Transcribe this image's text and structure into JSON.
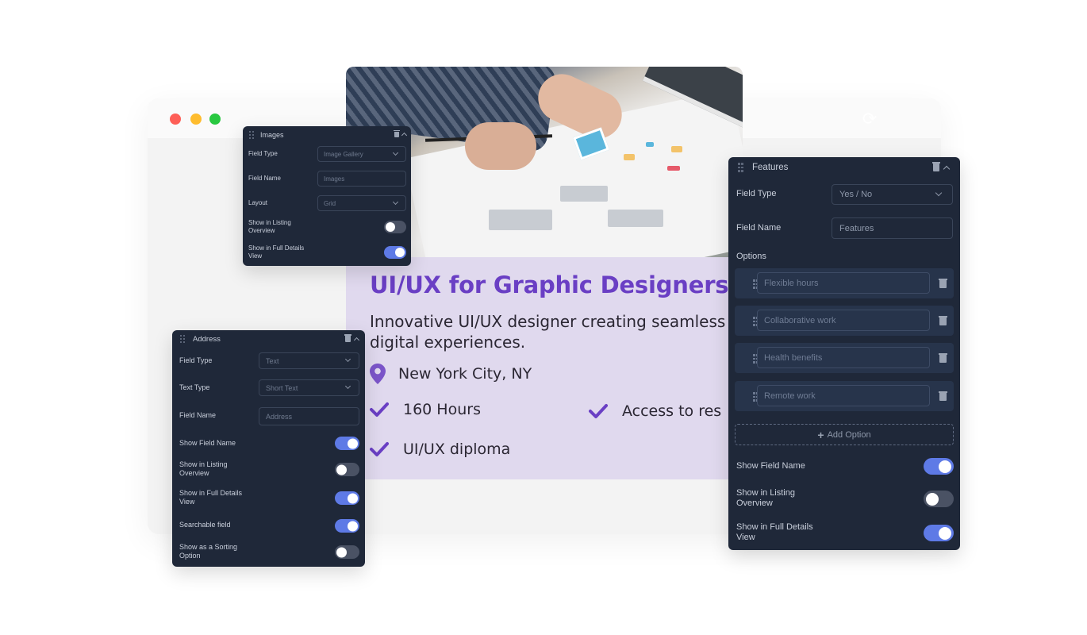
{
  "window": {
    "controls": [
      "close",
      "minimize",
      "maximize"
    ],
    "refresh_icon": "refresh-icon"
  },
  "course": {
    "title": "UI/UX for Graphic Designers",
    "description": "Innovative UI/UX designer creating seamless digital experiences.",
    "location": "New York City, NY",
    "features": [
      "160 Hours",
      "Access to res",
      "UI/UX diploma"
    ],
    "accent_color": "#6a3fc4",
    "background_color": "#e0d9ee"
  },
  "images_panel": {
    "title": "Images",
    "rows": [
      {
        "label": "Field Type",
        "value": "Image Gallery",
        "type": "select"
      },
      {
        "label": "Field Name",
        "value": "Images",
        "type": "input"
      },
      {
        "label": "Layout",
        "value": "Grid",
        "type": "select"
      }
    ],
    "toggles": [
      {
        "label": "Show in Listing Overview",
        "on": false
      },
      {
        "label": "Show in Full Details View",
        "on": true
      }
    ]
  },
  "address_panel": {
    "title": "Address",
    "rows": [
      {
        "label": "Field Type",
        "value": "Text",
        "type": "select"
      },
      {
        "label": "Text Type",
        "value": "Short Text",
        "type": "select"
      },
      {
        "label": "Field Name",
        "value": "Address",
        "type": "input"
      }
    ],
    "toggles": [
      {
        "label": "Show Field Name",
        "on": true
      },
      {
        "label": "Show in Listing Overview",
        "on": false
      },
      {
        "label": "Show in Full Details View",
        "on": true
      },
      {
        "label": "Searchable field",
        "on": true
      },
      {
        "label": "Show as a Sorting Option",
        "on": false
      }
    ]
  },
  "features_panel": {
    "title": "Features",
    "rows": [
      {
        "label": "Field Type",
        "value": "Yes / No",
        "type": "select"
      },
      {
        "label": "Field Name",
        "value": "Features",
        "type": "input"
      }
    ],
    "options_label": "Options",
    "options": [
      "Flexible hours",
      "Collaborative work",
      "Health benefits",
      "Remote work"
    ],
    "add_option_label": "Add Option",
    "toggles": [
      {
        "label": "Show Field Name",
        "on": true
      },
      {
        "label": "Show in Listing Overview",
        "on": false
      },
      {
        "label": "Show in Full Details View",
        "on": true
      }
    ]
  },
  "colors": {
    "panel_bg": "#1f2839",
    "toggle_on": "#5e7ae6",
    "toggle_off": "#4a5264"
  }
}
